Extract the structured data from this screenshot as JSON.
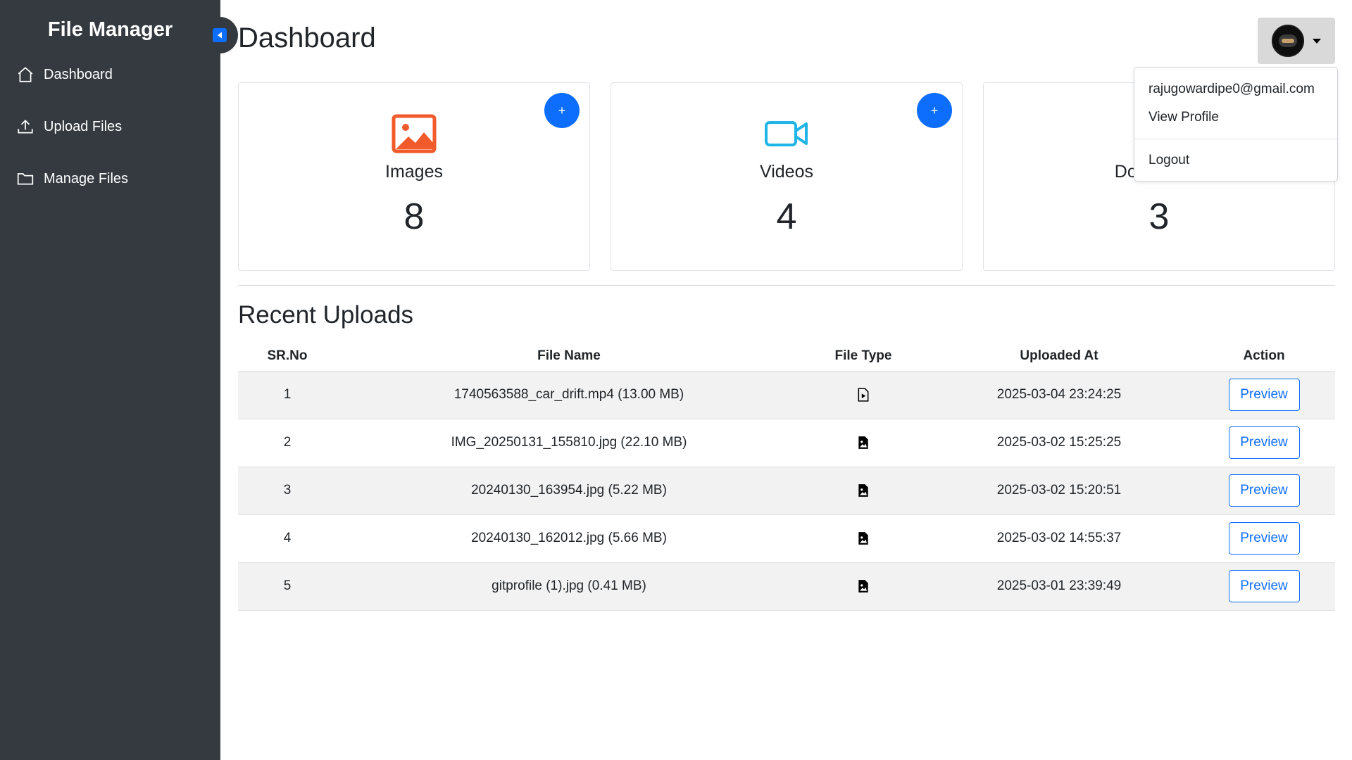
{
  "sidebar": {
    "brand": "File Manager",
    "items": [
      {
        "label": "Dashboard",
        "icon": "home-icon"
      },
      {
        "label": "Upload Files",
        "icon": "upload-icon"
      },
      {
        "label": "Manage Files",
        "icon": "folder-icon"
      }
    ]
  },
  "header": {
    "title": "Dashboard"
  },
  "cards": [
    {
      "label": "Images",
      "count": "8",
      "add": "+",
      "color": "#f15a2b"
    },
    {
      "label": "Videos",
      "count": "4",
      "add": "+",
      "color": "#1fb5e6"
    },
    {
      "label": "Documents",
      "count": "3",
      "add": "+"
    }
  ],
  "recent": {
    "title": "Recent Uploads",
    "columns": [
      "SR.No",
      "File Name",
      "File Type",
      "Uploaded At",
      "Action"
    ],
    "rows": [
      {
        "sr": "1",
        "name": "1740563588_car_drift.mp4 (13.00 MB)",
        "type": "video-file-icon",
        "date": "2025-03-04 23:24:25",
        "action": "Preview"
      },
      {
        "sr": "2",
        "name": "IMG_20250131_155810.jpg (22.10 MB)",
        "type": "image-file-icon",
        "date": "2025-03-02 15:25:25",
        "action": "Preview"
      },
      {
        "sr": "3",
        "name": "20240130_163954.jpg (5.22 MB)",
        "type": "image-file-icon",
        "date": "2025-03-02 15:20:51",
        "action": "Preview"
      },
      {
        "sr": "4",
        "name": "20240130_162012.jpg (5.66 MB)",
        "type": "image-file-icon",
        "date": "2025-03-02 14:55:37",
        "action": "Preview"
      },
      {
        "sr": "5",
        "name": "gitprofile (1).jpg (0.41 MB)",
        "type": "image-file-icon",
        "date": "2025-03-01 23:39:49",
        "action": "Preview"
      }
    ]
  },
  "user_menu": {
    "email": "rajugowardipe0@gmail.com",
    "view_profile": "View Profile",
    "logout": "Logout"
  },
  "colors": {
    "sidebar_bg": "#343a40",
    "primary": "#0d6efd",
    "striped_row": "#f2f2f2"
  }
}
